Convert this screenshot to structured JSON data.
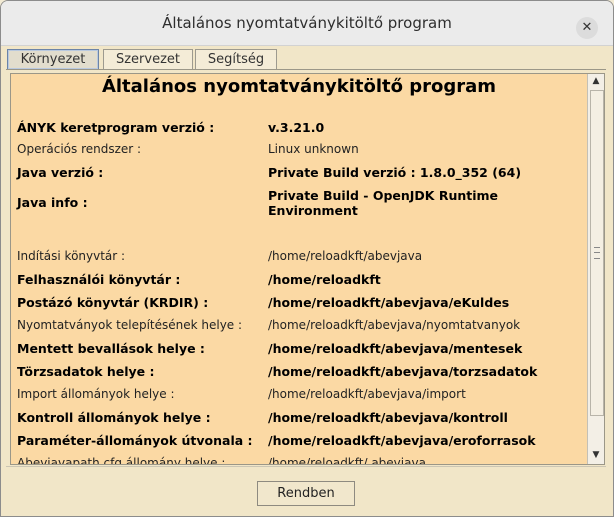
{
  "window": {
    "title": "Általános nyomtatványkitöltő program",
    "close_glyph": "✕"
  },
  "tabs": [
    {
      "label": "Környezet",
      "active": true
    },
    {
      "label": "Szervezet",
      "active": false
    },
    {
      "label": "Segítség",
      "active": false
    }
  ],
  "panel": {
    "heading": "Általános nyomtatványkitöltő program",
    "rows": [
      {
        "label": "ÁNYK keretprogram verzió :",
        "value": "v.3.21.0",
        "bold": true
      },
      {
        "label": "Operációs rendszer :",
        "value": "Linux unknown",
        "bold": false
      },
      {
        "label": "Java verzió :",
        "value": "Private Build verzió : 1.8.0_352 (64)",
        "bold": true
      },
      {
        "label": "Java info :",
        "value": "Private Build - OpenJDK Runtime Environment",
        "bold": true
      },
      {
        "label": "Indítási könyvtár :",
        "value": "/home/reloadkft/abevjava",
        "bold": false
      },
      {
        "label": "Felhasználói könyvtár :",
        "value": "/home/reloadkft",
        "bold": true
      },
      {
        "label": "Postázó könyvtár (KRDIR) :",
        "value": "/home/reloadkft/abevjava/eKuldes",
        "bold": true
      },
      {
        "label": "Nyomtatványok telepítésének helye :",
        "value": "/home/reloadkft/abevjava/nyomtatvanyok",
        "bold": false
      },
      {
        "label": "Mentett bevallások helye :",
        "value": "/home/reloadkft/abevjava/mentesek",
        "bold": true
      },
      {
        "label": "Törzsadatok helye :",
        "value": "/home/reloadkft/abevjava/torzsadatok",
        "bold": true
      },
      {
        "label": "Import állományok helye :",
        "value": "/home/reloadkft/abevjava/import",
        "bold": false
      },
      {
        "label": "Kontroll állományok helye :",
        "value": "/home/reloadkft/abevjava/kontroll",
        "bold": true
      },
      {
        "label": "Paraméter-állományok útvonala :",
        "value": "/home/reloadkft/abevjava/eroforrasok",
        "bold": true
      },
      {
        "label": "Abevjavapath.cfg állomány helye :",
        "value": "/home/reloadkft/.abevjava",
        "bold": false
      }
    ]
  },
  "scrollbar": {
    "up_glyph": "▲",
    "down_glyph": "▼"
  },
  "footer": {
    "ok_label": "Rendben"
  }
}
